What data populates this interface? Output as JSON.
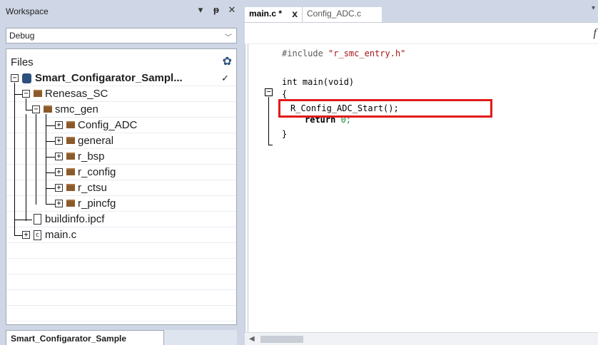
{
  "workspace": {
    "title": "Workspace",
    "buttons": {
      "dropdown": "▾",
      "pin": "ᵡ",
      "close": "✕"
    },
    "configuration": "Debug",
    "files_label": "Files",
    "tree": [
      {
        "label": "Smart_Configarator_Sampl...",
        "type": "project"
      },
      {
        "label": "Renesas_SC",
        "type": "folder"
      },
      {
        "label": "smc_gen",
        "type": "folder"
      },
      {
        "label": "Config_ADC",
        "type": "folder"
      },
      {
        "label": "general",
        "type": "folder"
      },
      {
        "label": "r_bsp",
        "type": "folder"
      },
      {
        "label": "r_config",
        "type": "folder"
      },
      {
        "label": "r_ctsu",
        "type": "folder"
      },
      {
        "label": "r_pincfg",
        "type": "folder"
      },
      {
        "label": "buildinfo.ipcf",
        "type": "file"
      },
      {
        "label": "main.c",
        "type": "c-file"
      }
    ],
    "project_checkmark": "✓",
    "bottom_tab": "Smart_Configarator_Sample"
  },
  "editor": {
    "tabs": [
      {
        "label": "main.c *",
        "active": true,
        "close": "x"
      },
      {
        "label": "Config_ADC.c",
        "active": false
      }
    ],
    "function_indicator": "f",
    "code": {
      "include_directive": "#include",
      "include_file": "\"r_smc_entry.h\"",
      "main_signature": "int main(void)",
      "open_brace": "{",
      "call": "R_Config_ADC_Start();",
      "return_kw": "return",
      "return_val": "0;",
      "close_brace": "}"
    }
  },
  "colors": {
    "panel_bg": "#cfd6e5",
    "highlight_border": "#e01b1b",
    "string": "#a31515",
    "number": "#1a8f3f"
  }
}
